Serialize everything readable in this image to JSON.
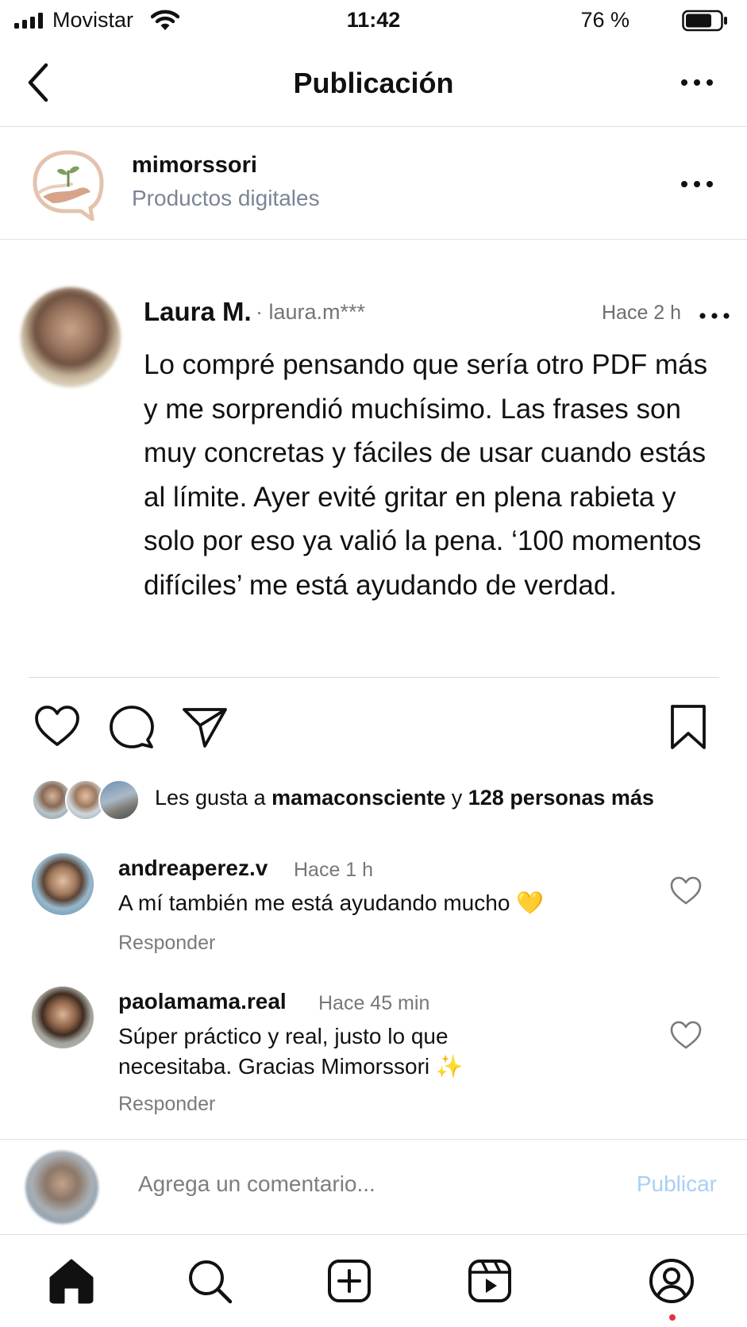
{
  "status_bar": {
    "carrier": "Movistar",
    "time": "11:42",
    "battery": "76 %",
    "battery_level": 0.76
  },
  "header": {
    "title": "Publicación"
  },
  "account": {
    "name": "mimorssori",
    "category": "Productos digitales"
  },
  "post": {
    "author": "Laura M.",
    "handle": "· laura.m***",
    "time": "Hace 2 h",
    "text": "Lo compré pensando que sería otro PDF más y me sorprendió muchísimo. Las frases son muy concretas y fáciles de usar cuando estás al límite. Ayer evité gritar en plena rabieta y solo por eso ya valió la pena. ‘100 momentos difíciles’ me está ayudando de verdad."
  },
  "likes": {
    "prefix": "Les gusta a",
    "user": "mamaconsciente",
    "joiner": "y",
    "others": "128 personas más"
  },
  "comments": [
    {
      "user": "andreaperez.v",
      "time": "Hace 1 h",
      "text": "A mí también me está ayudando mucho 💛",
      "reply": "Responder"
    },
    {
      "user": "paolamama.real",
      "time": "Hace 45 min",
      "text": "Súper práctico y real, justo lo que necesitaba. Gracias Mimorssori ✨",
      "reply": "Responder"
    }
  ],
  "compose": {
    "placeholder": "Agrega un comentario...",
    "publish": "Publicar"
  },
  "icons": {
    "back": "chevron-left-icon",
    "more": "more-horizontal-icon",
    "like": "heart-icon",
    "comment": "comment-icon",
    "share": "send-icon",
    "save": "bookmark-icon",
    "tabs": [
      "home-icon",
      "search-icon",
      "create-icon",
      "reels-icon",
      "profile-icon"
    ]
  },
  "colors": {
    "secondary_text": "#7a8596",
    "publish_disabled": "#a9cff5",
    "notification_dot": "#e0313d"
  }
}
